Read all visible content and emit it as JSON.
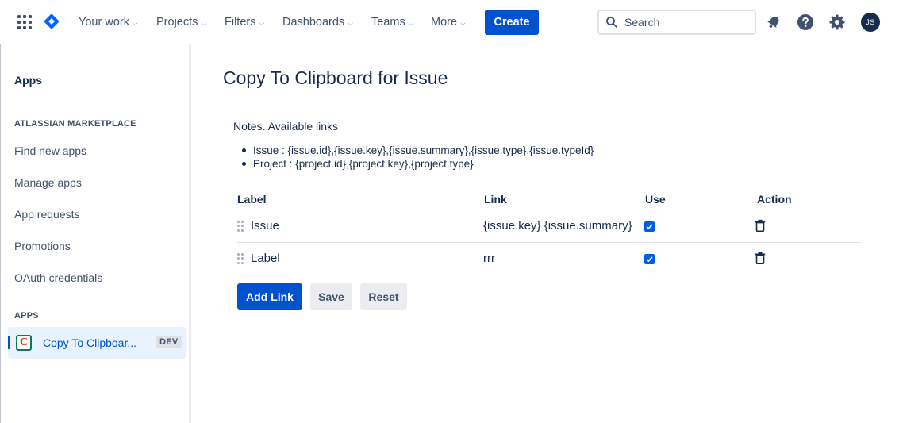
{
  "topnav": {
    "items": [
      {
        "label": "Your work"
      },
      {
        "label": "Projects"
      },
      {
        "label": "Filters"
      },
      {
        "label": "Dashboards"
      },
      {
        "label": "Teams"
      },
      {
        "label": "More"
      }
    ],
    "create_label": "Create",
    "search_placeholder": "Search",
    "avatar_initials": "JS",
    "icons": [
      "app-switcher-icon",
      "jira-logo-icon",
      "search-icon",
      "notifications-icon",
      "help-icon",
      "settings-icon"
    ]
  },
  "sidebar": {
    "title": "Apps",
    "marketplace_heading": "ATLASSIAN MARKETPLACE",
    "links": [
      {
        "label": "Find new apps"
      },
      {
        "label": "Manage apps"
      },
      {
        "label": "App requests"
      },
      {
        "label": "Promotions"
      },
      {
        "label": "OAuth credentials"
      }
    ],
    "apps_heading": "APPS",
    "active_app": {
      "label": "Copy To Clipboar...",
      "badge": "DEV",
      "icon_letter": "C"
    }
  },
  "main": {
    "title": "Copy To Clipboard for Issue",
    "notes_title": "Notes. Available links",
    "notes": [
      "Issue : {issue.id},{issue.key},{issue.summary},{issue.type},{issue.typeId}",
      "Project : {project.id},{project.key},{project.type}"
    ],
    "table": {
      "headers": {
        "label": "Label",
        "link": "Link",
        "use": "Use",
        "action": "Action"
      },
      "rows": [
        {
          "label": "Issue",
          "link": "{issue.key} {issue.summary}",
          "use": true
        },
        {
          "label": "Label",
          "link": "rrr",
          "use": true
        }
      ]
    },
    "buttons": {
      "add_link": "Add Link",
      "save": "Save",
      "reset": "Reset"
    }
  },
  "colors": {
    "primary": "#0052cc",
    "text": "#172b4d",
    "muted": "#42526e",
    "border": "#dfe1e6",
    "selected_bg": "#e9f2ff"
  }
}
